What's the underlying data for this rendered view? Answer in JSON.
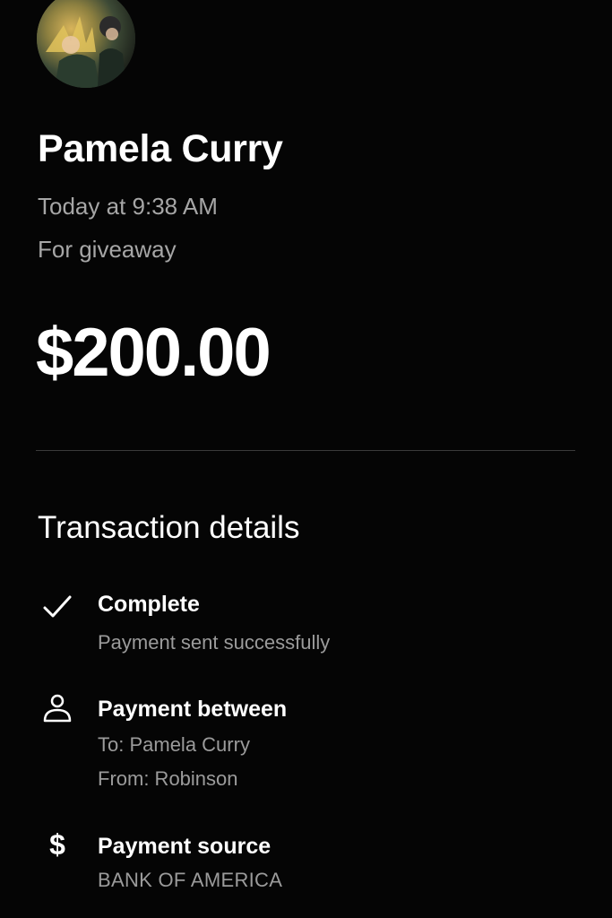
{
  "recipient": {
    "name": "Pamela Curry",
    "time": "Today at 9:38 AM",
    "note": "For giveaway",
    "amount": "$200.00",
    "avatar_icon": "profile-photo"
  },
  "details": {
    "title": "Transaction details",
    "status": {
      "icon": "checkmark-icon",
      "label": "Complete",
      "description": "Payment sent successfully"
    },
    "parties": {
      "icon": "person-icon",
      "label": "Payment between",
      "to": "To: Pamela Curry",
      "from": "From: Robinson"
    },
    "source": {
      "icon": "dollar-icon",
      "icon_glyph": "$",
      "label": "Payment source",
      "bank": "BANK OF AMERICA"
    }
  },
  "colors": {
    "background": "#050505",
    "primary_text": "#ffffff",
    "secondary_text": "#a6a6a6",
    "divider": "#3a3a3a"
  }
}
